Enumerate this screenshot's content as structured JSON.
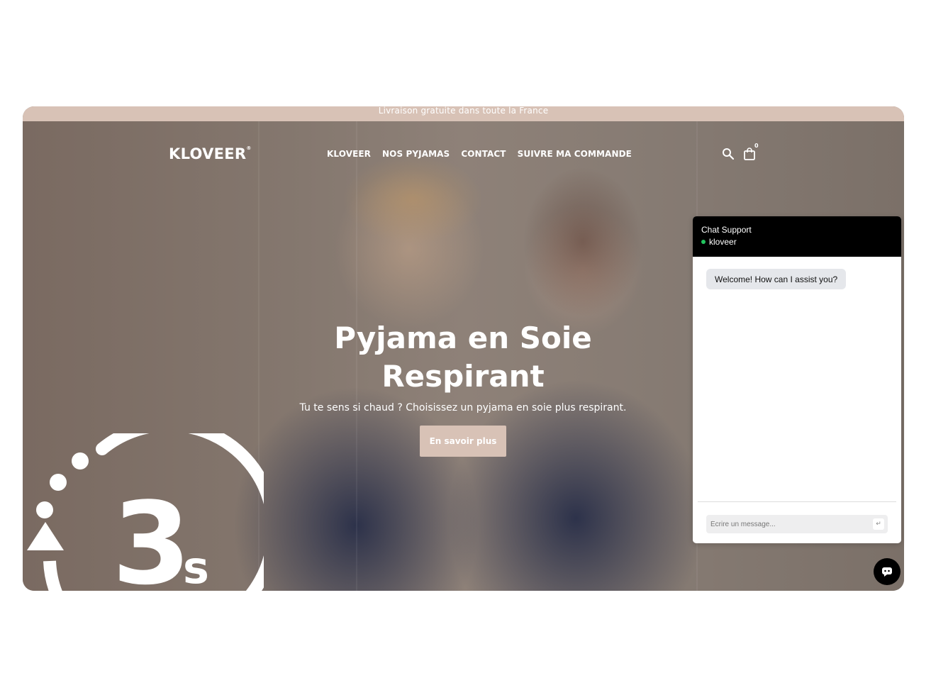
{
  "announcement": {
    "text": "Livraison gratuite dans toute la France"
  },
  "header": {
    "logo": "KLOVEER",
    "logo_mark": "®",
    "nav": [
      {
        "label": "KLOVEER"
      },
      {
        "label": "NOS PYJAMAS"
      },
      {
        "label": "CONTACT"
      },
      {
        "label": "SUIVRE MA COMMANDE"
      }
    ],
    "cart_count": "0",
    "icons": [
      "search-icon",
      "cart-icon"
    ]
  },
  "hero": {
    "title_line1": "Pyjama en Soie",
    "title_line2": "Respirant",
    "subtitle": "Tu te sens si chaud ? Choisissez un pyjama en soie plus respirant.",
    "button": "En savoir plus"
  },
  "timer_overlay": {
    "digit": "3",
    "unit": "s"
  },
  "chat": {
    "title": "Chat Support",
    "agent": "kloveer",
    "status_color": "#22c55e",
    "welcome_message": "Welcome! How can I assist you?",
    "input_placeholder": "Écrire un message...",
    "send_icon": "↵"
  },
  "colors": {
    "accent": "#d8c2b6",
    "chat_header": "#000000"
  }
}
